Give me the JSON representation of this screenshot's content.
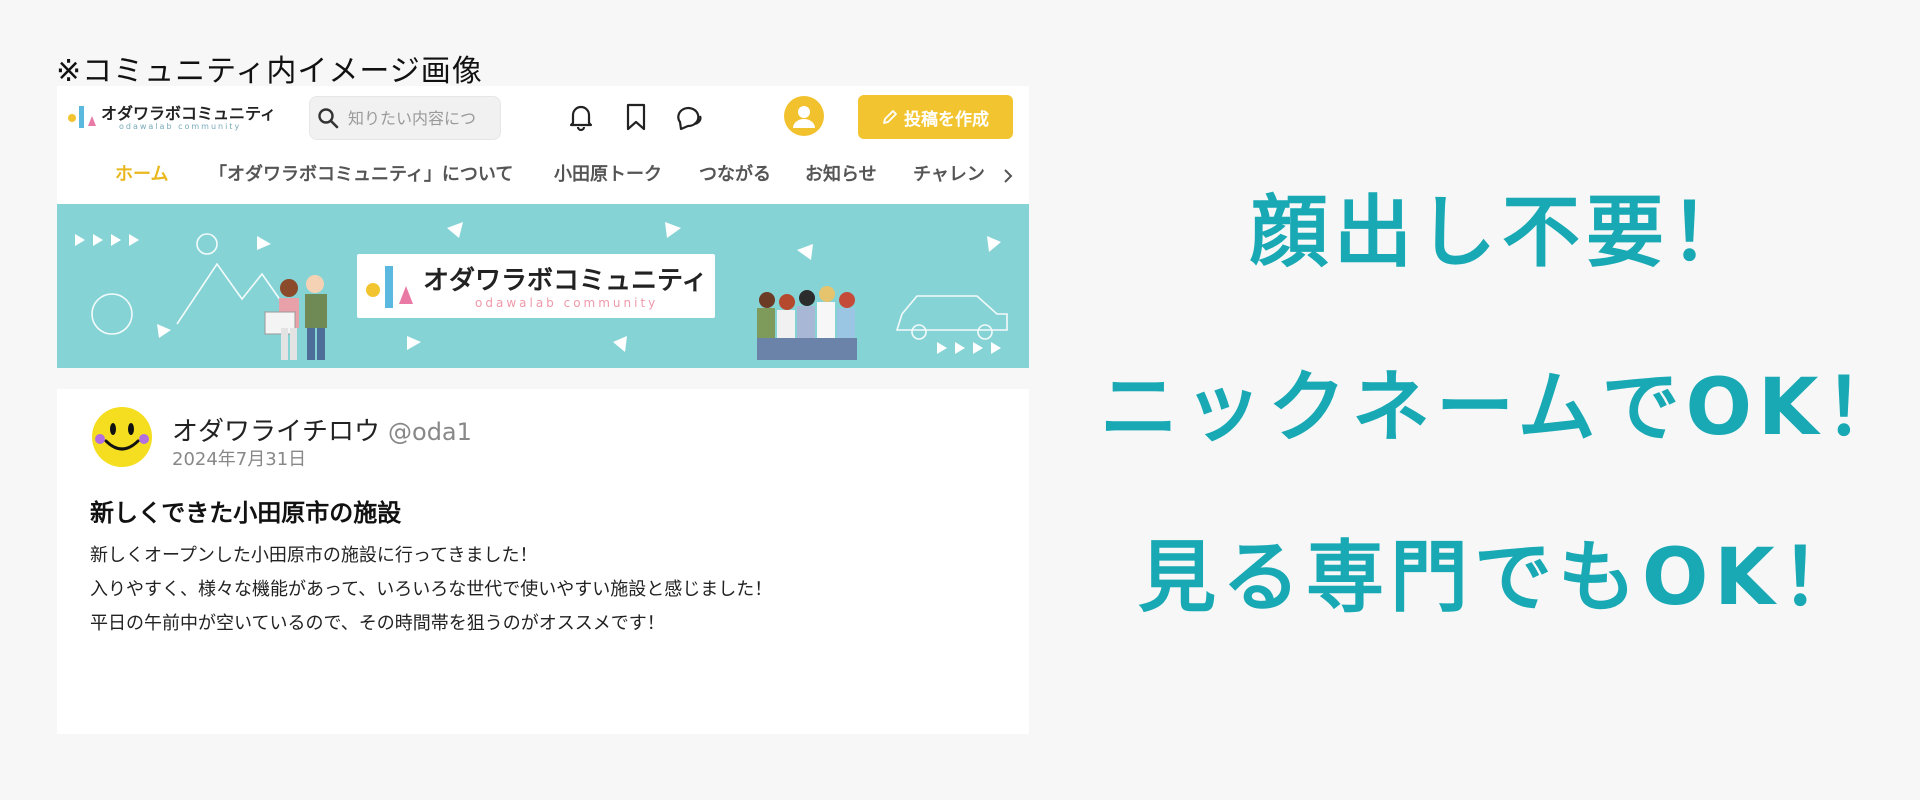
{
  "caption": "※コミュニティ内イメージ画像",
  "header": {
    "logo_text": "オダワラボコミュニティ",
    "logo_sub": "odawalab community",
    "search_placeholder": "知りたい内容につ",
    "post_button": "投稿を作成"
  },
  "tabs": [
    {
      "label": "ホーム",
      "active": true
    },
    {
      "label": "「オダワラボコミュニティ」について"
    },
    {
      "label": "小田原トーク"
    },
    {
      "label": "つながる"
    },
    {
      "label": "お知らせ"
    },
    {
      "label": "チャレン"
    }
  ],
  "banner": {
    "title": "オダワラボコミュニティ",
    "subtitle": "odawalab community"
  },
  "post": {
    "author": "オダワライチロウ",
    "handle": "@oda1",
    "date": "2024年7月31日",
    "title": "新しくできた小田原市の施設",
    "body": [
      "新しくオープンした小田原市の施設に行ってきました！",
      "入りやすく、様々な機能があって、いろいろな世代で使いやすい施設と感じました！",
      "平日の午前中が空いているので、その時間帯を狙うのがオススメです！"
    ]
  },
  "slogans": [
    "顔出し不要！",
    "ニックネームでOK！",
    "見る専門でもOK！"
  ],
  "colors": {
    "accent_yellow": "#f2c530",
    "banner_teal": "#86d3d6",
    "slogan_teal": "#18a9b4"
  },
  "icons": [
    "search-icon",
    "bell-icon",
    "bookmark-icon",
    "chat-icon",
    "user-icon",
    "pencil-icon",
    "chevron-right-icon",
    "smiley-icon"
  ]
}
